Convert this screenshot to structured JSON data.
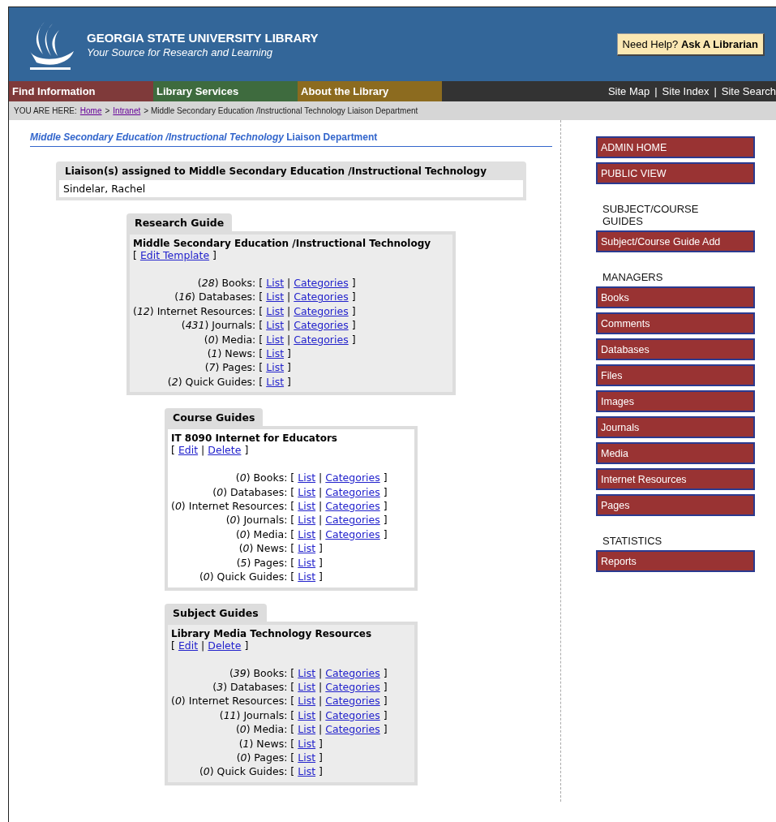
{
  "header": {
    "title": "GEORGIA STATE UNIVERSITY LIBRARY",
    "tagline": "Your Source for Research and Learning",
    "help": "Need Help? **Ask A Librarian**"
  },
  "nav": {
    "tabs": [
      {
        "label": "Find Information",
        "color": "#7f3a3a"
      },
      {
        "label": "Library Services",
        "color": "#3e6b3e"
      },
      {
        "label": "About the Library",
        "color": "#8c6b1f"
      }
    ],
    "links": [
      "Site Map",
      "|",
      "Site Index",
      "|",
      "Site Search"
    ]
  },
  "breadcrumb": [
    {
      "kind": "text",
      "text": "YOU ARE HERE:"
    },
    {
      "kind": "link",
      "text": "Home"
    },
    {
      "kind": "text",
      "text": ">"
    },
    {
      "kind": "link",
      "text": "Intranet"
    },
    {
      "kind": "text",
      "text": "> Middle Secondary Education /Instructional Technology Liaison Department"
    }
  ],
  "page_title": "*Middle Secondary Education /Instructional Technology* Liaison Department",
  "liaison": {
    "heading": "Liaison(s) assigned to Middle Secondary Education /Instructional Technology",
    "name": "Sindelar, Rachel"
  },
  "sections": [
    {
      "kind": "template",
      "shaded": true,
      "tab": "Research Guide",
      "title": "Middle Secondary Education /Instructional Technology",
      "actions": [
        "[",
        "Edit Template",
        "]"
      ],
      "rows": [
        {
          "label": "(*28*) Books:",
          "parts": [
            "[",
            "List",
            "|",
            "Categories",
            "]"
          ]
        },
        {
          "label": "(*16*) Databases:",
          "parts": [
            "[",
            "List",
            "|",
            "Categories",
            "]"
          ]
        },
        {
          "label": "(*12*) Internet Resources:",
          "parts": [
            "[",
            "List",
            "|",
            "Categories",
            "]"
          ]
        },
        {
          "label": "(*431*) Journals:",
          "parts": [
            "[",
            "List",
            "|",
            "Categories",
            "]"
          ]
        },
        {
          "label": "(*0*) Media:",
          "parts": [
            "[",
            "List",
            "|",
            "Categories",
            "]"
          ]
        },
        {
          "label": "(*1*) News:",
          "parts": [
            "[",
            "List",
            "]"
          ]
        },
        {
          "label": "(*7*) Pages:",
          "parts": [
            "[",
            "List",
            "]"
          ]
        },
        {
          "label": "(*2*) Quick Guides:",
          "parts": [
            "[",
            "List",
            "]"
          ]
        }
      ]
    },
    {
      "kind": "guide",
      "shaded": false,
      "tab": "Course Guides",
      "title": "IT 8090 Internet for Educators",
      "actions": [
        "[",
        "Edit",
        "|",
        "Delete",
        "]"
      ],
      "rows": [
        {
          "label": "(*0*) Books:",
          "parts": [
            "[",
            "List",
            "|",
            "Categories",
            "]"
          ]
        },
        {
          "label": "(*0*) Databases:",
          "parts": [
            "[",
            "List",
            "|",
            "Categories",
            "]"
          ]
        },
        {
          "label": "(*0*) Internet Resources:",
          "parts": [
            "[",
            "List",
            "|",
            "Categories",
            "]"
          ]
        },
        {
          "label": "(*0*) Journals:",
          "parts": [
            "[",
            "List",
            "|",
            "Categories",
            "]"
          ]
        },
        {
          "label": "(*0*) Media:",
          "parts": [
            "[",
            "List",
            "|",
            "Categories",
            "]"
          ]
        },
        {
          "label": "(*0*) News:",
          "parts": [
            "[",
            "List",
            "]"
          ]
        },
        {
          "label": "(*5*) Pages:",
          "parts": [
            "[",
            "List",
            "]"
          ]
        },
        {
          "label": "(*0*) Quick Guides:",
          "parts": [
            "[",
            "List",
            "]"
          ]
        }
      ]
    },
    {
      "kind": "guide",
      "shaded": true,
      "tab": "Subject Guides",
      "title": "Library Media Technology Resources",
      "actions": [
        "[",
        "Edit",
        "|",
        "Delete",
        "]"
      ],
      "rows": [
        {
          "label": "(*39*) Books:",
          "parts": [
            "[",
            "List",
            "|",
            "Categories",
            "]"
          ]
        },
        {
          "label": "(*3*) Databases:",
          "parts": [
            "[",
            "List",
            "|",
            "Categories",
            "]"
          ]
        },
        {
          "label": "(*0*) Internet Resources:",
          "parts": [
            "[",
            "List",
            "|",
            "Categories",
            "]"
          ]
        },
        {
          "label": "(*11*) Journals:",
          "parts": [
            "[",
            "List",
            "|",
            "Categories",
            "]"
          ]
        },
        {
          "label": "(*0*) Media:",
          "parts": [
            "[",
            "List",
            "|",
            "Categories",
            "]"
          ]
        },
        {
          "label": "(*1*) News:",
          "parts": [
            "[",
            "List",
            "]"
          ]
        },
        {
          "label": "(*0*) Pages:",
          "parts": [
            "[",
            "List",
            "]"
          ]
        },
        {
          "label": "(*0*) Quick Guides:",
          "parts": [
            "[",
            "List",
            "]"
          ]
        }
      ]
    }
  ],
  "sidebar": {
    "items": [
      {
        "kind": "button",
        "label": "ADMIN HOME"
      },
      {
        "kind": "button",
        "label": "PUBLIC VIEW"
      },
      {
        "kind": "heading",
        "label": "SUBJECT/COURSE GUIDES"
      },
      {
        "kind": "button",
        "label": "Subject/Course Guide Add"
      },
      {
        "kind": "heading",
        "label": "MANAGERS"
      },
      {
        "kind": "button",
        "label": "Books"
      },
      {
        "kind": "button",
        "label": "Comments"
      },
      {
        "kind": "button",
        "label": "Databases"
      },
      {
        "kind": "button",
        "label": "Files"
      },
      {
        "kind": "button",
        "label": "Images"
      },
      {
        "kind": "button",
        "label": "Journals"
      },
      {
        "kind": "button",
        "label": "Media"
      },
      {
        "kind": "button",
        "label": "Internet Resources"
      },
      {
        "kind": "button",
        "label": "Pages"
      },
      {
        "kind": "heading",
        "label": "STATISTICS"
      },
      {
        "kind": "button",
        "label": "Reports"
      }
    ]
  }
}
